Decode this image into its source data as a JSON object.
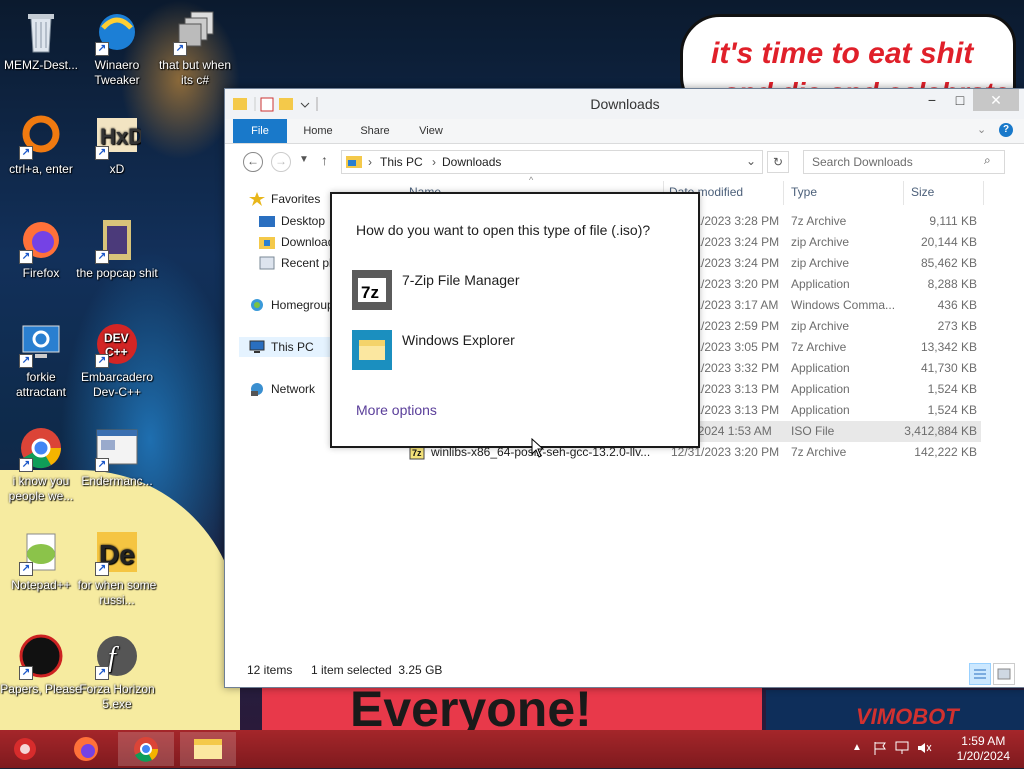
{
  "wallpaper": {
    "speech_text_1": "it's time to eat shit",
    "speech_text_2": "and die and celebrate",
    "banner_text": "Everyone!",
    "right_deco_text": "VIMOBOT"
  },
  "desktop_icons": [
    {
      "label": "MEMZ-Dest...",
      "icon": "recycle-bin-icon"
    },
    {
      "label": "Winaero Tweaker",
      "icon": "winaero-icon"
    },
    {
      "label": "that but when its c#",
      "icon": "stacked-windows-icon"
    },
    {
      "label": "ctrl+a, enter",
      "icon": "ring-icon"
    },
    {
      "label": "xD",
      "icon": "hxd-icon"
    },
    {
      "label": "Firefox",
      "icon": "firefox-icon"
    },
    {
      "label": "the popcap shit",
      "icon": "popcap-icon"
    },
    {
      "label": "forkie attractant",
      "icon": "gear-monitor-icon"
    },
    {
      "label": "Embarcadero Dev-C++",
      "icon": "devcpp-icon"
    },
    {
      "label": "i know you people we...",
      "icon": "chrome-icon"
    },
    {
      "label": "Endermanc...",
      "icon": "app-window-icon"
    },
    {
      "label": "Notepad++",
      "icon": "notepadpp-icon"
    },
    {
      "label": "for when some russi...",
      "icon": "de-icon"
    },
    {
      "label": "Papers, Please",
      "icon": "papers-please-icon"
    },
    {
      "label": "Forza Horizon 5.exe",
      "icon": "flash-icon"
    }
  ],
  "explorer": {
    "title": "Downloads",
    "tabs": [
      "File",
      "Home",
      "Share",
      "View"
    ],
    "breadcrumb": [
      "This PC",
      "Downloads"
    ],
    "search_placeholder": "Search Downloads",
    "nav": {
      "favorites": "Favorites",
      "desktop": "Desktop",
      "downloads": "Downloads",
      "recent": "Recent places",
      "homegroup": "Homegroup",
      "this_pc": "This PC",
      "network": "Network"
    },
    "columns": [
      "Name",
      "Date modified",
      "Type",
      "Size"
    ],
    "rows": [
      {
        "name": "",
        "date": "12/31/2023 3:28 PM",
        "type": "7z Archive",
        "size": "9,111 KB"
      },
      {
        "name": "",
        "date": "12/31/2023 3:24 PM",
        "type": "zip Archive",
        "size": "20,144 KB"
      },
      {
        "name": "",
        "date": "12/31/2023 3:24 PM",
        "type": "zip Archive",
        "size": "85,462 KB"
      },
      {
        "name": "",
        "date": "12/31/2023 3:20 PM",
        "type": "Application",
        "size": "8,288 KB"
      },
      {
        "name": "",
        "date": "12/31/2023 3:17 AM",
        "type": "Windows Comma...",
        "size": "436 KB"
      },
      {
        "name": "",
        "date": "12/31/2023 2:59 PM",
        "type": "zip Archive",
        "size": "273 KB"
      },
      {
        "name": "",
        "date": "12/31/2023 3:05 PM",
        "type": "7z Archive",
        "size": "13,342 KB"
      },
      {
        "name": "",
        "date": "12/31/2023 3:32 PM",
        "type": "Application",
        "size": "41,730 KB"
      },
      {
        "name": "",
        "date": "12/31/2023 3:13 PM",
        "type": "Application",
        "size": "1,524 KB"
      },
      {
        "name": "",
        "date": "12/31/2023 3:13 PM",
        "type": "Application",
        "size": "1,524 KB"
      },
      {
        "name": "",
        "date": "1/20/2024 1:53 AM",
        "type": "ISO File",
        "size": "3,412,884 KB"
      },
      {
        "name": "winlibs-x86_64-posix-seh-gcc-13.2.0-llv...",
        "date": "12/31/2023 3:20 PM",
        "type": "7z Archive",
        "size": "142,222 KB"
      }
    ],
    "status": {
      "items": "12 items",
      "selected": "1 item selected  3.25 GB"
    }
  },
  "dialog": {
    "question": "How do you want to open this type of file (.iso)?",
    "options": [
      {
        "label": "7-Zip File Manager",
        "icon": "7zip-icon"
      },
      {
        "label": "Windows Explorer",
        "icon": "windows-explorer-icon"
      }
    ],
    "more": "More options"
  },
  "taskbar": {
    "time": "1:59 AM",
    "date": "1/20/2024"
  },
  "colors": {
    "taskbar": "#8f1f24",
    "ribbon_file": "#1979ca",
    "dialog_link": "#5a3e9a"
  }
}
